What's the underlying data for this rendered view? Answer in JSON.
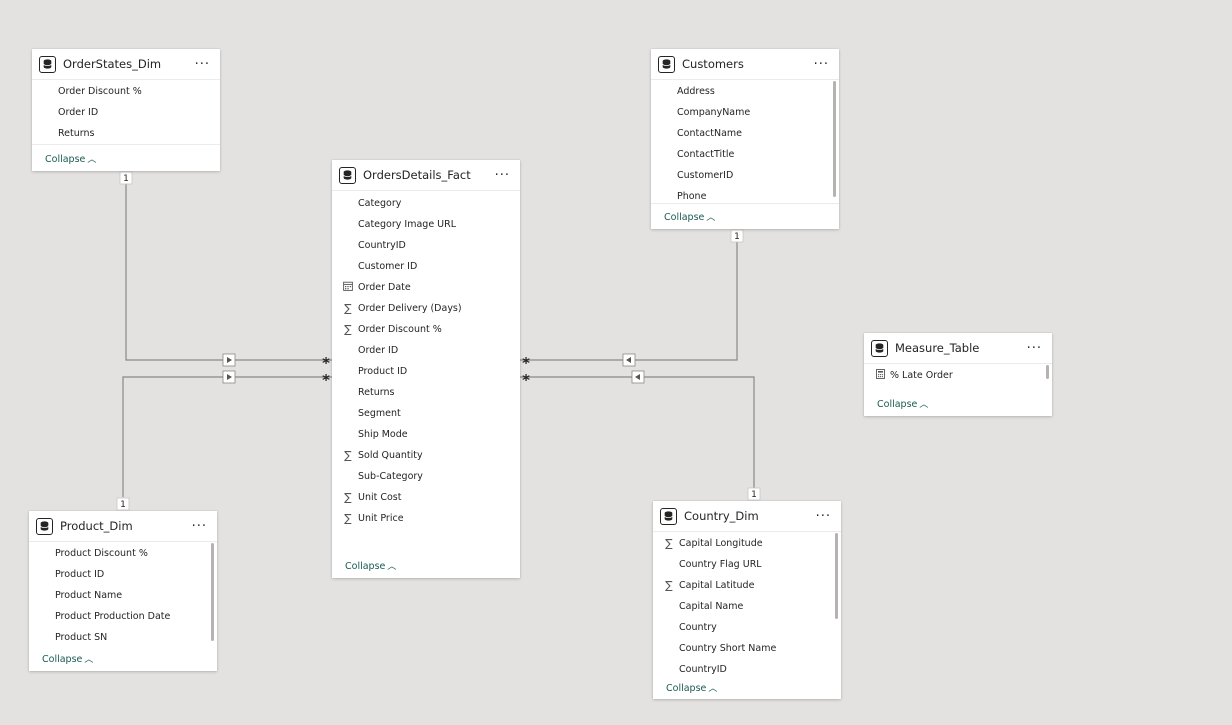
{
  "tables": {
    "order_states": {
      "title": "OrderStates_Dim",
      "fields": [
        {
          "label": "Order Discount %",
          "icon": "none"
        },
        {
          "label": "Order ID",
          "icon": "none"
        },
        {
          "label": "Returns",
          "icon": "none"
        }
      ],
      "collapse": "Collapse"
    },
    "orders_fact": {
      "title": "OrdersDetails_Fact",
      "fields": [
        {
          "label": "Category",
          "icon": "none"
        },
        {
          "label": "Category Image URL",
          "icon": "none"
        },
        {
          "label": "CountryID",
          "icon": "none"
        },
        {
          "label": "Customer ID",
          "icon": "none"
        },
        {
          "label": "Order Date",
          "icon": "calendar-icon"
        },
        {
          "label": "Order Delivery (Days)",
          "icon": "sigma-icon"
        },
        {
          "label": "Order Discount %",
          "icon": "sigma-icon"
        },
        {
          "label": "Order ID",
          "icon": "none"
        },
        {
          "label": "Product ID",
          "icon": "none"
        },
        {
          "label": "Returns",
          "icon": "none"
        },
        {
          "label": "Segment",
          "icon": "none"
        },
        {
          "label": "Ship Mode",
          "icon": "none"
        },
        {
          "label": "Sold Quantity",
          "icon": "sigma-icon"
        },
        {
          "label": "Sub-Category",
          "icon": "none"
        },
        {
          "label": "Unit Cost",
          "icon": "sigma-icon"
        },
        {
          "label": "Unit Price",
          "icon": "sigma-icon"
        }
      ],
      "collapse": "Collapse"
    },
    "customers": {
      "title": "Customers",
      "fields": [
        {
          "label": "Address",
          "icon": "none"
        },
        {
          "label": "CompanyName",
          "icon": "none"
        },
        {
          "label": "ContactName",
          "icon": "none"
        },
        {
          "label": "ContactTitle",
          "icon": "none"
        },
        {
          "label": "CustomerID",
          "icon": "none"
        },
        {
          "label": "Phone",
          "icon": "none"
        }
      ],
      "collapse": "Collapse"
    },
    "measure_table": {
      "title": "Measure_Table",
      "fields": [
        {
          "label": "% Late Order",
          "icon": "calculator-icon"
        }
      ],
      "collapse": "Collapse"
    },
    "product_dim": {
      "title": "Product_Dim",
      "fields": [
        {
          "label": "Product Discount %",
          "icon": "none"
        },
        {
          "label": "Product ID",
          "icon": "none"
        },
        {
          "label": "Product Name",
          "icon": "none"
        },
        {
          "label": "Product Production Date",
          "icon": "none"
        },
        {
          "label": "Product SN",
          "icon": "none"
        }
      ],
      "collapse": "Collapse"
    },
    "country_dim": {
      "title": "Country_Dim",
      "fields": [
        {
          "label": "Capital Longitude",
          "icon": "sigma-icon"
        },
        {
          "label": "Country Flag URL",
          "icon": "none"
        },
        {
          "label": "Capital Latitude",
          "icon": "sigma-icon"
        },
        {
          "label": "Capital Name",
          "icon": "none"
        },
        {
          "label": "Country",
          "icon": "none"
        },
        {
          "label": "Country Short Name",
          "icon": "none"
        },
        {
          "label": "CountryID",
          "icon": "none"
        }
      ],
      "collapse": "Collapse"
    }
  },
  "relationships": {
    "one_label": "1",
    "many_label": "*"
  },
  "colors": {
    "canvas": "#e4e2e0",
    "line": "#8a8886",
    "collapse_link": "#1a5a52"
  }
}
